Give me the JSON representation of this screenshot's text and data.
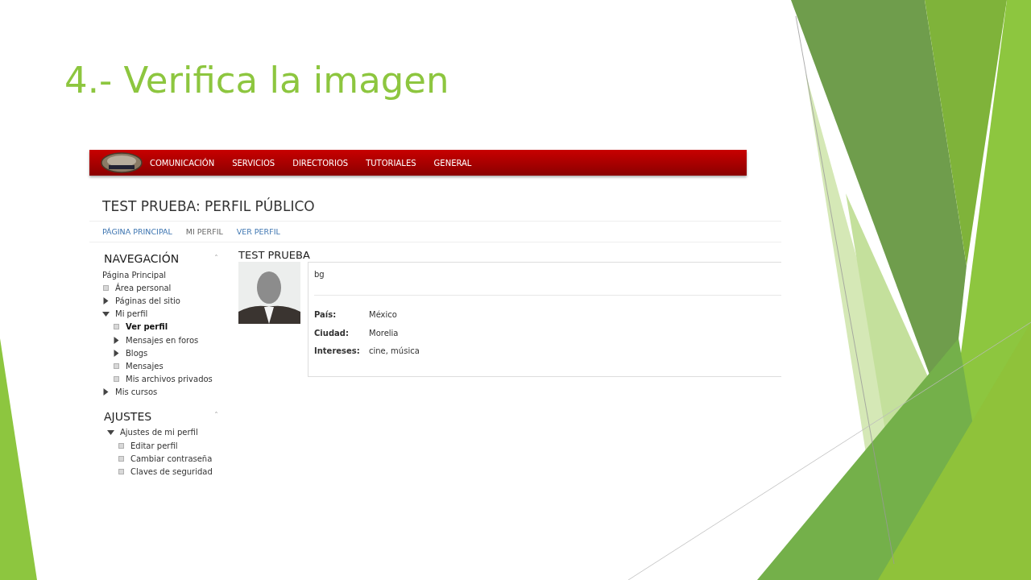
{
  "slide": {
    "title": "4.- Verifica la imagen"
  },
  "menu_bar": {
    "items": [
      "COMUNICACIÓN",
      "SERVICIOS",
      "DIRECTORIOS",
      "TUTORIALES",
      "GENERAL"
    ]
  },
  "page": {
    "title": "TEST PRUEBA: PERFIL PÚBLICO",
    "breadcrumbs": [
      {
        "label": "PÁGINA PRINCIPAL",
        "kind": "link"
      },
      {
        "label": "MI PERFIL",
        "kind": "text"
      },
      {
        "label": "VER PERFIL",
        "kind": "link"
      }
    ]
  },
  "blocks": [
    {
      "title": "NAVEGACIÓN",
      "collapse_icon": "ˆ",
      "items": [
        {
          "label": "Página Principal",
          "kind": "plain",
          "selected": false
        },
        {
          "label": "Área personal",
          "kind": "leaf",
          "selected": false
        },
        {
          "label": "Páginas del sitio",
          "kind": "branch",
          "expanded": false,
          "selected": false
        },
        {
          "label": "Mi perfil",
          "kind": "branch",
          "expanded": true,
          "selected": false,
          "children": [
            {
              "label": "Ver perfil",
              "kind": "leaf",
              "selected": true
            },
            {
              "label": "Mensajes en foros",
              "kind": "branch",
              "expanded": false,
              "selected": false
            },
            {
              "label": "Blogs",
              "kind": "branch",
              "expanded": false,
              "selected": false
            },
            {
              "label": "Mensajes",
              "kind": "leaf",
              "selected": false
            },
            {
              "label": "Mis archivos privados",
              "kind": "leaf",
              "selected": false
            }
          ]
        },
        {
          "label": "Mis cursos",
          "kind": "branch",
          "expanded": false,
          "selected": false
        }
      ]
    },
    {
      "title": "AJUSTES",
      "collapse_icon": "ˆ",
      "items": [
        {
          "label": "Ajustes de mi perfil",
          "kind": "branch",
          "expanded": true,
          "selected": false,
          "children": [
            {
              "label": "Editar perfil",
              "kind": "leaf",
              "selected": false
            },
            {
              "label": "Cambiar contraseña",
              "kind": "leaf",
              "selected": false
            },
            {
              "label": "Claves de seguridad",
              "kind": "leaf",
              "selected": false
            }
          ]
        }
      ]
    }
  ],
  "profile": {
    "name": "TEST PRUEBA",
    "description": "bg",
    "fields": [
      {
        "label": "País:",
        "value": "México"
      },
      {
        "label": "Ciudad:",
        "value": "Morelia"
      },
      {
        "label": "Intereses:",
        "value": "cine, música"
      }
    ]
  }
}
